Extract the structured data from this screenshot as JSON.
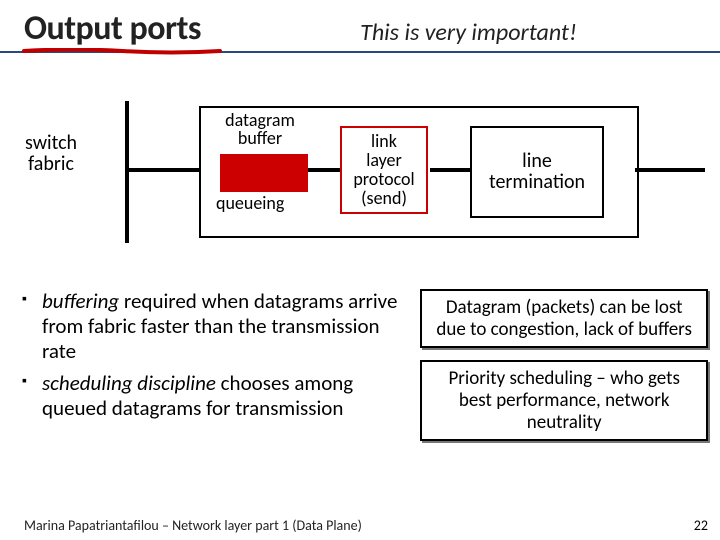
{
  "header": {
    "title": "Output ports",
    "important": "This is very important!"
  },
  "diagram": {
    "fabric": "switch\nfabric",
    "datagram_buffer": "datagram\nbuffer",
    "queueing": "queueing",
    "protocol": "link\nlayer\nprotocol\n(send)",
    "termination": "line\ntermination"
  },
  "bullets": [
    {
      "em": "buffering",
      "rest": " required when datagrams arrive from fabric faster than the transmission rate"
    },
    {
      "em": "scheduling discipline",
      "rest": " chooses among queued datagrams for transmission"
    }
  ],
  "callouts": [
    "Datagram (packets) can be lost due to congestion, lack of buffers",
    "Priority scheduling – who gets best performance, network neutrality"
  ],
  "footer": {
    "text": "Marina Papatriantafilou –  Network layer part 1 (Data Plane)",
    "page": "22"
  }
}
